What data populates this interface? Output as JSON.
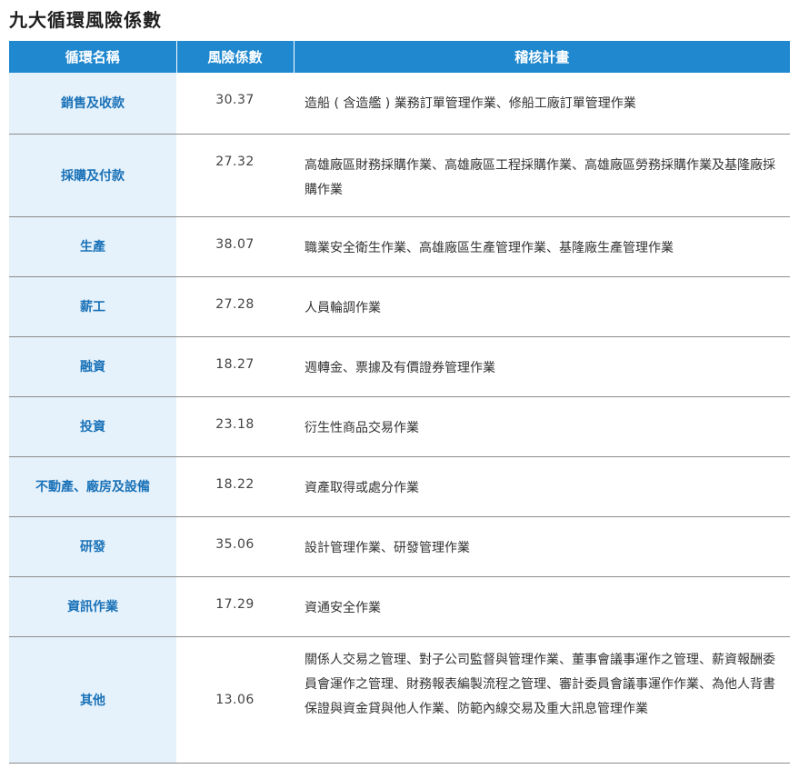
{
  "title": "九大循環風險係數",
  "headers": [
    "循環名稱",
    "風險係數",
    "稽核計畫"
  ],
  "rows": [
    {
      "cycle": "銷售及收款",
      "coef": "30.37",
      "plan": "造船 ( 含造艦 ) 業務訂單管理作業、修船工廠訂單管理作業"
    },
    {
      "cycle": "採購及付款",
      "coef": "27.32",
      "plan": "高雄廠區財務採購作業、高雄廠區工程採購作業、高雄廠區勞務採購作業及基隆廠採購作業"
    },
    {
      "cycle": "生產",
      "coef": "38.07",
      "plan": "職業安全衛生作業、高雄廠區生產管理作業、基隆廠生產管理作業"
    },
    {
      "cycle": "薪工",
      "coef": "27.28",
      "plan": "人員輪調作業"
    },
    {
      "cycle": "融資",
      "coef": "18.27",
      "plan": "週轉金、票據及有價證券管理作業"
    },
    {
      "cycle": "投資",
      "coef": "23.18",
      "plan": "衍生性商品交易作業"
    },
    {
      "cycle": "不動產、廠房及設備",
      "coef": "18.22",
      "plan": "資產取得或處分作業"
    },
    {
      "cycle": "研發",
      "coef": "35.06",
      "plan": "設計管理作業、研發管理作業"
    },
    {
      "cycle": "資訊作業",
      "coef": "17.29",
      "plan": "資通安全作業"
    },
    {
      "cycle": "其他",
      "coef": "13.06",
      "plan": "關係人交易之管理、對子公司監督與管理作業、董事會議事運作之管理、薪資報酬委員會運作之管理、財務報表編製流程之管理、審計委員會議事運作作業、為他人背書保證與資金貸與他人作業、防範內線交易及重大訊息管理作業"
    }
  ]
}
